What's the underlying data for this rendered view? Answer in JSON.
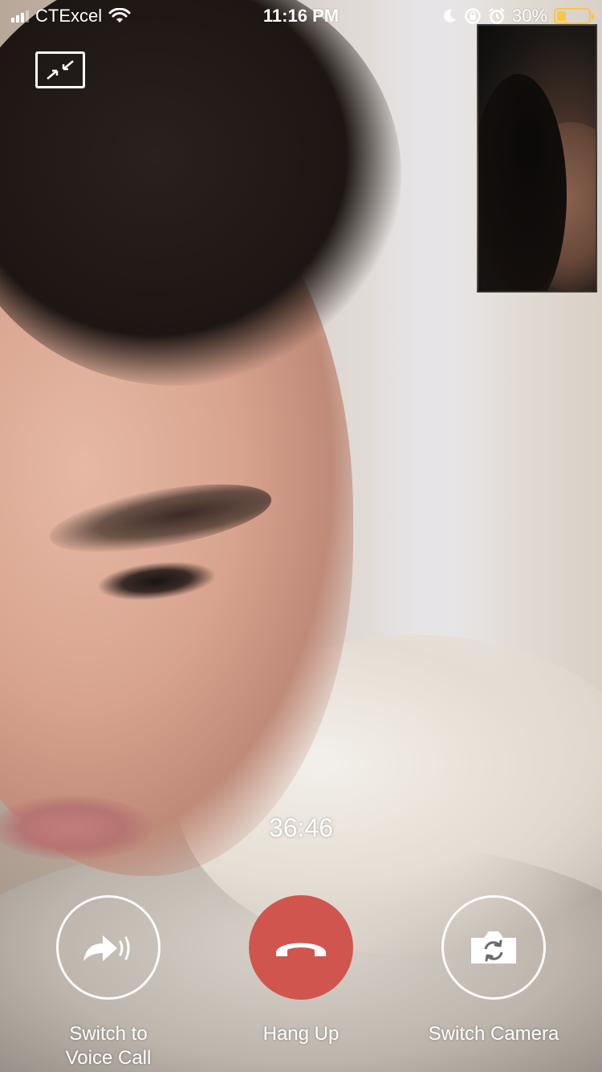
{
  "status_bar": {
    "carrier": "CTExcel",
    "time": "11:16 PM",
    "battery_percent": "30%",
    "battery_level": 0.3,
    "icons": [
      "signal-icon",
      "wifi-icon",
      "moon-icon",
      "rotation-lock-icon",
      "alarm-icon",
      "battery-icon"
    ],
    "battery_color": "#f5c842"
  },
  "call": {
    "timer": "36:46",
    "minimize_icon": "minimize-icon"
  },
  "controls": {
    "voice": {
      "label": "Switch to\nVoice Call",
      "icon": "phone-forward-icon"
    },
    "hangup": {
      "label": "Hang Up",
      "icon": "hangup-icon",
      "color": "#d0554f"
    },
    "camera": {
      "label": "Switch Camera",
      "icon": "camera-switch-icon"
    }
  }
}
